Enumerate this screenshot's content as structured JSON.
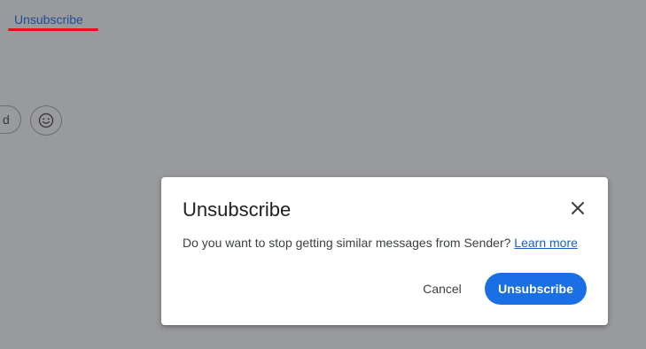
{
  "background": {
    "unsubscribe_link": "Unsubscribe",
    "chip_fragment": "d",
    "emoji_icon": "smiley-icon"
  },
  "dialog": {
    "title": "Unsubscribe",
    "message": "Do you want to stop getting similar messages from Sender?",
    "learn_more": "Learn more",
    "cancel_label": "Cancel",
    "confirm_label": "Unsubscribe",
    "close_icon": "close-icon"
  },
  "colors": {
    "overlay": "#999a9c",
    "link": "#1e4d9b",
    "highlight_underline": "#e0121b",
    "primary_button": "#1b6fe4"
  }
}
